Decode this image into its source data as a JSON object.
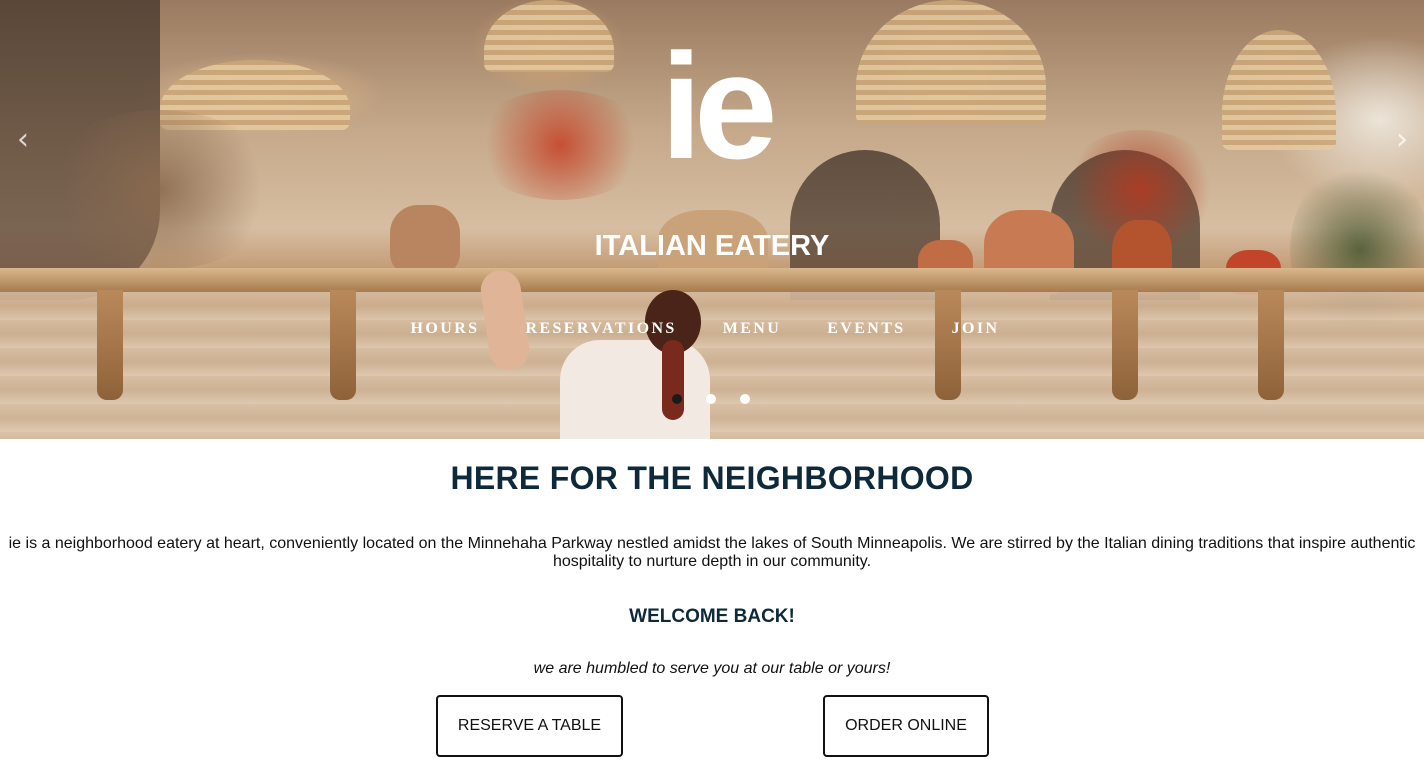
{
  "hero": {
    "logo_text": "ie",
    "subtitle": "ITALIAN EATERY",
    "nav": [
      {
        "label": "HOURS"
      },
      {
        "label": "RESERVATIONS"
      },
      {
        "label": "MENU"
      },
      {
        "label": "EVENTS"
      },
      {
        "label": "JOIN"
      }
    ],
    "carousel": {
      "prev_symbol": "‹",
      "next_symbol": "›",
      "slide_count": 3,
      "active_slide": 1
    }
  },
  "main": {
    "headline": "HERE FOR THE NEIGHBORHOOD",
    "intro": "ie is a neighborhood eatery at heart, conveniently located on the Minnehaha Parkway nestled amidst the lakes of South Minneapolis. We are stirred by the Italian dining traditions that inspire authentic hospitality to nurture depth in our community.",
    "welcome": "WELCOME BACK!",
    "tagline": "we are humbled to serve you at our table or yours!",
    "buttons": {
      "reserve": "RESERVE A TABLE",
      "order": "ORDER ONLINE"
    }
  },
  "colors": {
    "heading": "#0e2a3a",
    "nav_text": "#ffffff",
    "button_border": "#111111"
  }
}
